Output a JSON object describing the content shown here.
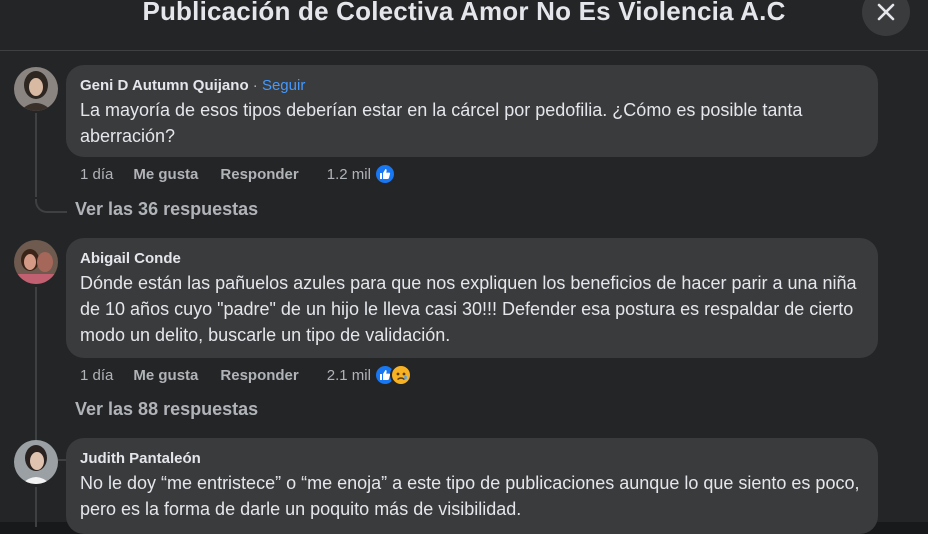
{
  "header": {
    "title": "Publicación de Colectiva Amor No Es Violencia A.C"
  },
  "comments": [
    {
      "author": "Geni D Autumn Quijano",
      "separator": " · ",
      "follow": "Seguir",
      "text": "La mayoría de esos tipos deberían estar en la cárcel por pedofilia. ¿Cómo es posible tanta aberración?",
      "time": "1 día",
      "like": "Me gusta",
      "reply": "Responder",
      "reaction_count": "1.2 mil",
      "reactions": [
        "like-icon"
      ],
      "view_replies": "Ver las 36 respuestas"
    },
    {
      "author": "Abigail Conde",
      "text": "Dónde están las pañuelos azules para que nos expliquen los beneficios de hacer parir a una niña de 10 años cuyo \"padre\" de un hijo le lleva casi 30!!! Defender esa postura es respaldar de cierto modo un delito, buscarle un tipo de validación.",
      "time": "1 día",
      "like": "Me gusta",
      "reply": "Responder",
      "reaction_count": "2.1 mil",
      "reactions": [
        "like-icon",
        "sad-icon"
      ],
      "view_replies": "Ver las 88 respuestas"
    },
    {
      "author": "Judith Pantaleón",
      "text": "No le doy “me entristece” o “me enoja” a este tipo de publicaciones aunque lo que siento es poco, pero es la forma de darle un poquito más de visibilidad."
    }
  ],
  "colors": {
    "background": "#242526",
    "bubble": "#3a3b3c",
    "link": "#4599ff",
    "like": "#1877f2",
    "sad": "#f7b125"
  }
}
